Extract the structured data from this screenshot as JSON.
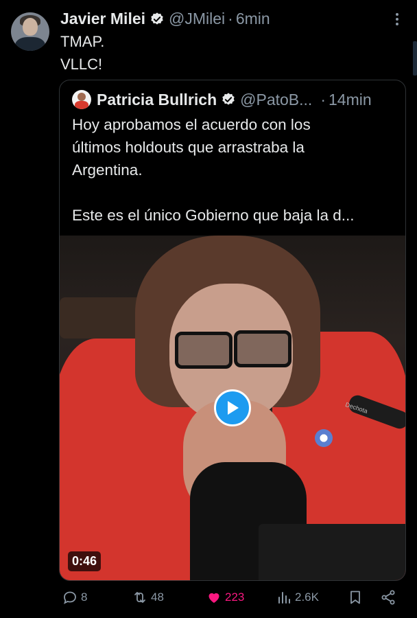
{
  "post": {
    "author_name": "Javier Milei",
    "author_handle": "@JMilei",
    "separator": "·",
    "time": "6min",
    "lines": [
      "TMAP.",
      "VLLC!"
    ]
  },
  "quote": {
    "author_name": "Patricia Bullrich",
    "author_handle": "@PatoB...",
    "separator": "·",
    "time": "14min",
    "lines": [
      "Hoy aprobamos el acuerdo con los",
      "últimos holdouts que arrastraba la",
      "Argentina.",
      "Este es el único Gobierno que baja la d..."
    ],
    "video": {
      "duration": "0:46",
      "mic_label": "Dechota"
    }
  },
  "actions": {
    "replies": "8",
    "reposts": "48",
    "likes": "223",
    "views": "2.6K"
  },
  "colors": {
    "background": "#000000",
    "text": "#e7e9ea",
    "muted": "#8b98a5",
    "accent": "#1d9bf0",
    "like": "#f91880"
  },
  "icons": [
    "verified-icon",
    "more-icon",
    "play-icon",
    "reply-icon",
    "repost-icon",
    "like-icon",
    "views-icon",
    "bookmark-icon",
    "share-icon"
  ]
}
